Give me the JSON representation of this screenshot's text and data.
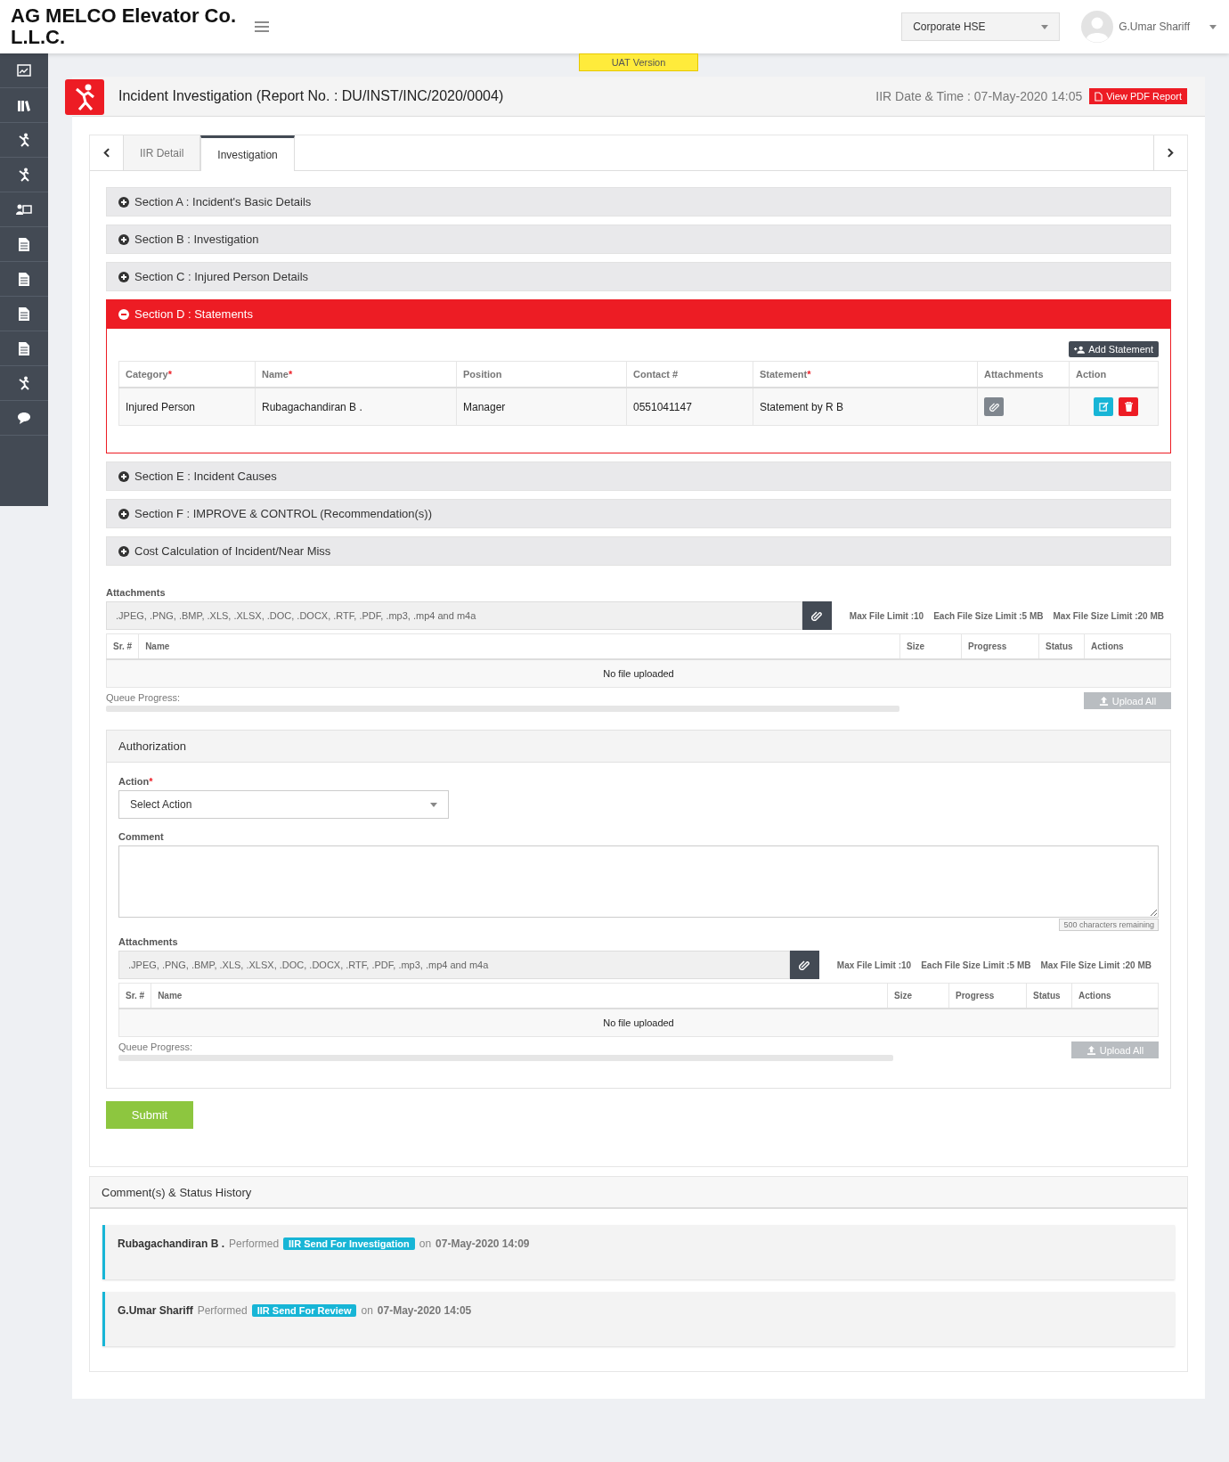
{
  "brand": "AG MELCO Elevator Co. L.L.C.",
  "header": {
    "company_select": "Corporate HSE",
    "user_name": "G.Umar Shariff"
  },
  "uat_badge": "UAT Version",
  "page": {
    "title": "Incident Investigation (Report No. : DU/INST/INC/2020/0004)",
    "datetime": "IIR Date & Time : 07-May-2020 14:05",
    "pdf_button": "View PDF Report"
  },
  "tabs": [
    {
      "label": "IIR Detail",
      "selected": false
    },
    {
      "label": "Investigation",
      "selected": true
    }
  ],
  "sections": [
    {
      "title": "Section A : Incident's Basic Details",
      "expanded": false
    },
    {
      "title": "Section B : Investigation",
      "expanded": false
    },
    {
      "title": "Section C : Injured Person Details",
      "expanded": false
    },
    {
      "title": "Section D : Statements",
      "expanded": true,
      "statements": {
        "add_button": "Add Statement",
        "columns": [
          {
            "label": "Category",
            "mark": "*"
          },
          {
            "label": "Name",
            "mark": "*"
          },
          {
            "label": "Position"
          },
          {
            "label": "Contact #"
          },
          {
            "label": "Statement",
            "mark": "*"
          },
          {
            "label": "Attachments"
          },
          {
            "label": "Action"
          }
        ],
        "rows": [
          {
            "cells": [
              "Injured Person",
              "Rubagachandiran B .",
              "Manager",
              "0551041147",
              "Statement by R B"
            ]
          }
        ]
      }
    },
    {
      "title": "Section E : Incident Causes",
      "expanded": false
    },
    {
      "title": "Section F : IMPROVE & CONTROL (Recommendation(s))",
      "expanded": false
    },
    {
      "title": "Cost Calculation of Incident/Near Miss",
      "expanded": false
    }
  ],
  "attachments": {
    "label": "Attachments",
    "placeholder": ".JPEG, .PNG, .BMP, .XLS, .XLSX, .DOC, .DOCX, .RTF, .PDF, .mp3, .mp4 and m4a",
    "limits": [
      "Max File Limit :10",
      "Each File Size Limit :5 MB",
      "Max File Size Limit :20 MB"
    ],
    "columns": [
      "Sr. #",
      "Name",
      "Size",
      "Progress",
      "Status",
      "Actions"
    ],
    "empty": "No file uploaded",
    "queue_label": "Queue Progress:",
    "queue": {
      "level": 0
    },
    "upload_button": {
      "label": "Upload All",
      "disabled": true
    }
  },
  "authorization": {
    "title": "Authorization",
    "action_label": "Action",
    "action_mark": "*",
    "action_value": "Select Action",
    "comment_label": "Comment",
    "chars_remaining": "500 characters remaining",
    "attachments": {
      "label": "Attachments",
      "placeholder": ".JPEG, .PNG, .BMP, .XLS, .XLSX, .DOC, .DOCX, .RTF, .PDF, .mp3, .mp4 and m4a",
      "limits": [
        "Max File Limit :10",
        "Each File Size Limit :5 MB",
        "Max File Size Limit :20 MB"
      ],
      "columns": [
        "Sr. #",
        "Name",
        "Size",
        "Progress",
        "Status",
        "Actions"
      ],
      "empty": "No file uploaded",
      "queue_label": "Queue Progress:",
      "queue": {
        "level": 0
      },
      "upload_button": {
        "label": "Upload All",
        "disabled": true
      }
    }
  },
  "submit": "Submit",
  "history": {
    "title": "Comment(s) & Status History",
    "entries": [
      {
        "user": "Rubagachandiran B .",
        "verb": "Performed",
        "status": "IIR Send For Investigation",
        "on": "on",
        "date": "07-May-2020 14:09"
      },
      {
        "user": "G.Umar Shariff",
        "verb": "Performed",
        "status": "IIR Send For Review",
        "on": "on",
        "date": "07-May-2020 14:05"
      }
    ]
  }
}
